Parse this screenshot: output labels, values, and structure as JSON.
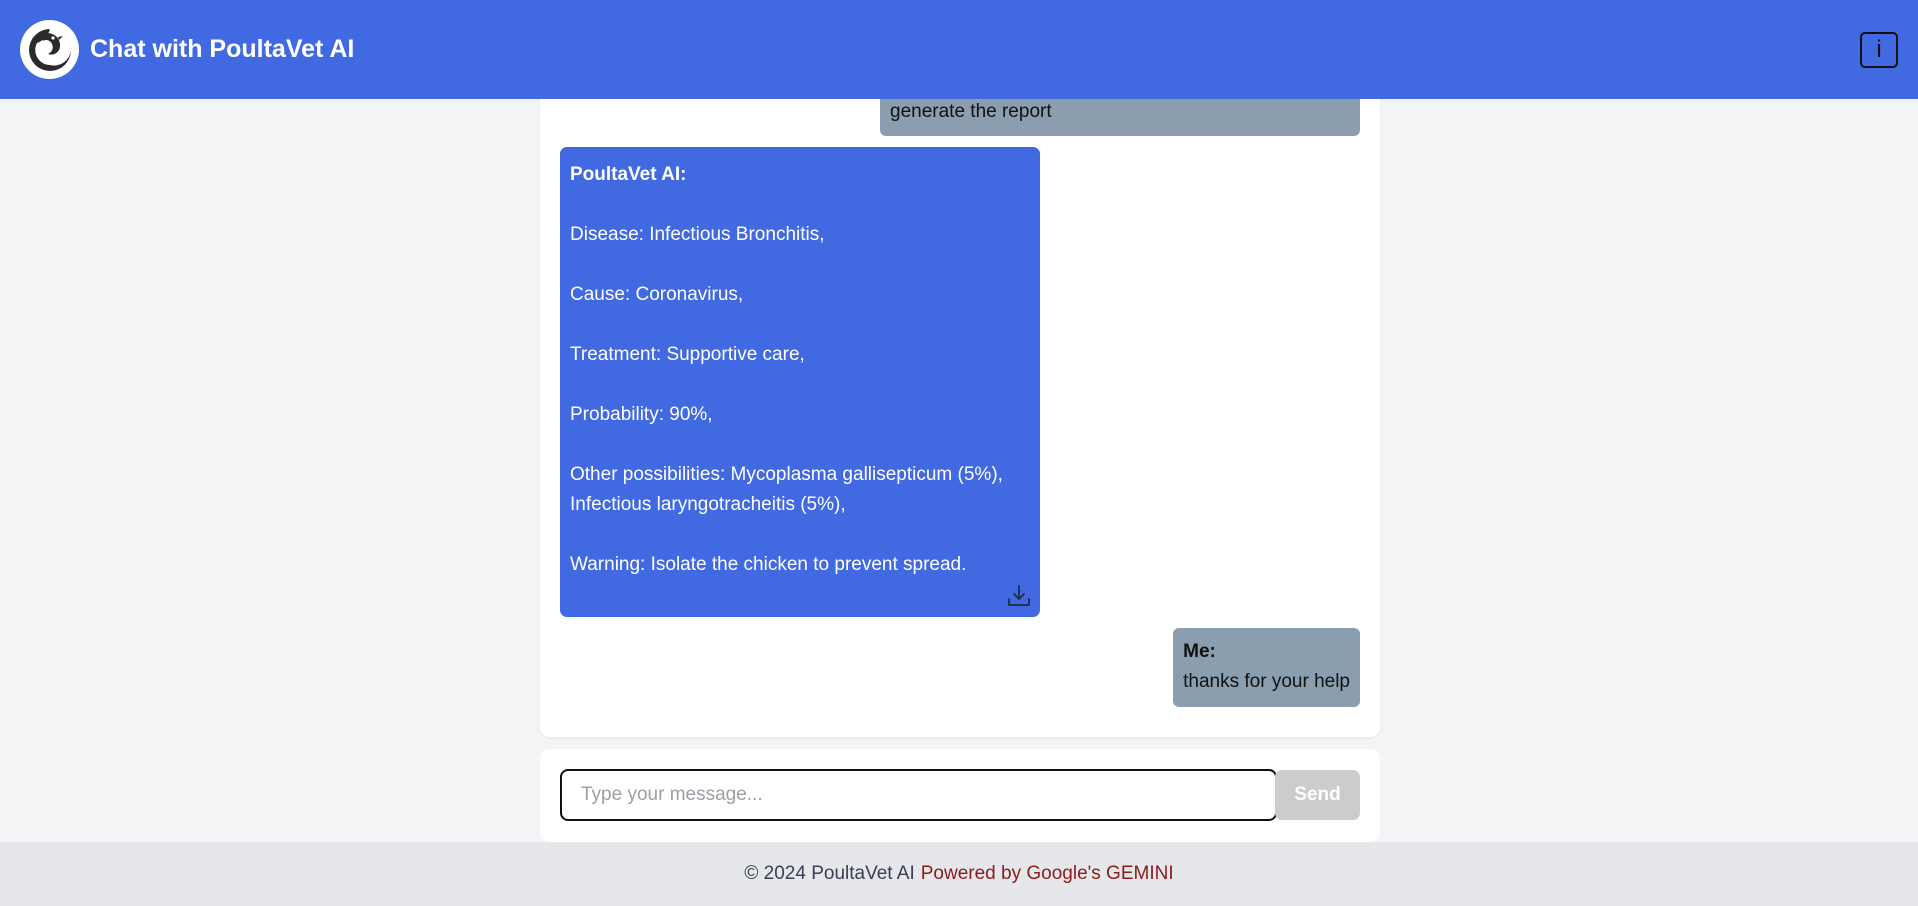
{
  "header": {
    "title": "Chat with PoultaVet AI",
    "info_label": "i",
    "logo_icon": "hen-logo-icon"
  },
  "messages": {
    "user_1": {
      "text": "generate the report"
    },
    "ai_1": {
      "sender": "PoultaVet AI:",
      "lines": {
        "disease": "Disease: Infectious Bronchitis,",
        "cause": "Cause: Coronavirus,",
        "treatment": "Treatment: Supportive care,",
        "probability": "Probability: 90%,",
        "other_1": "Other possibilities: Mycoplasma gallisepticum (5%),",
        "other_2": "Infectious laryngotracheitis (5%),",
        "warning": "Warning: Isolate the chicken to prevent spread."
      },
      "download_icon": "download-icon"
    },
    "user_2": {
      "sender": "Me:",
      "text": "thanks for your help"
    }
  },
  "composer": {
    "placeholder": "Type your message...",
    "value": "",
    "send_label": "Send"
  },
  "footer": {
    "copyright": "© 2024 PoultaVet AI",
    "powered": "Powered by Google's GEMINI"
  },
  "colors": {
    "primary": "#4169e1",
    "user_bubble": "#8a9eaf",
    "send_disabled": "#cccccc",
    "footer_link": "#8b1c1c"
  }
}
